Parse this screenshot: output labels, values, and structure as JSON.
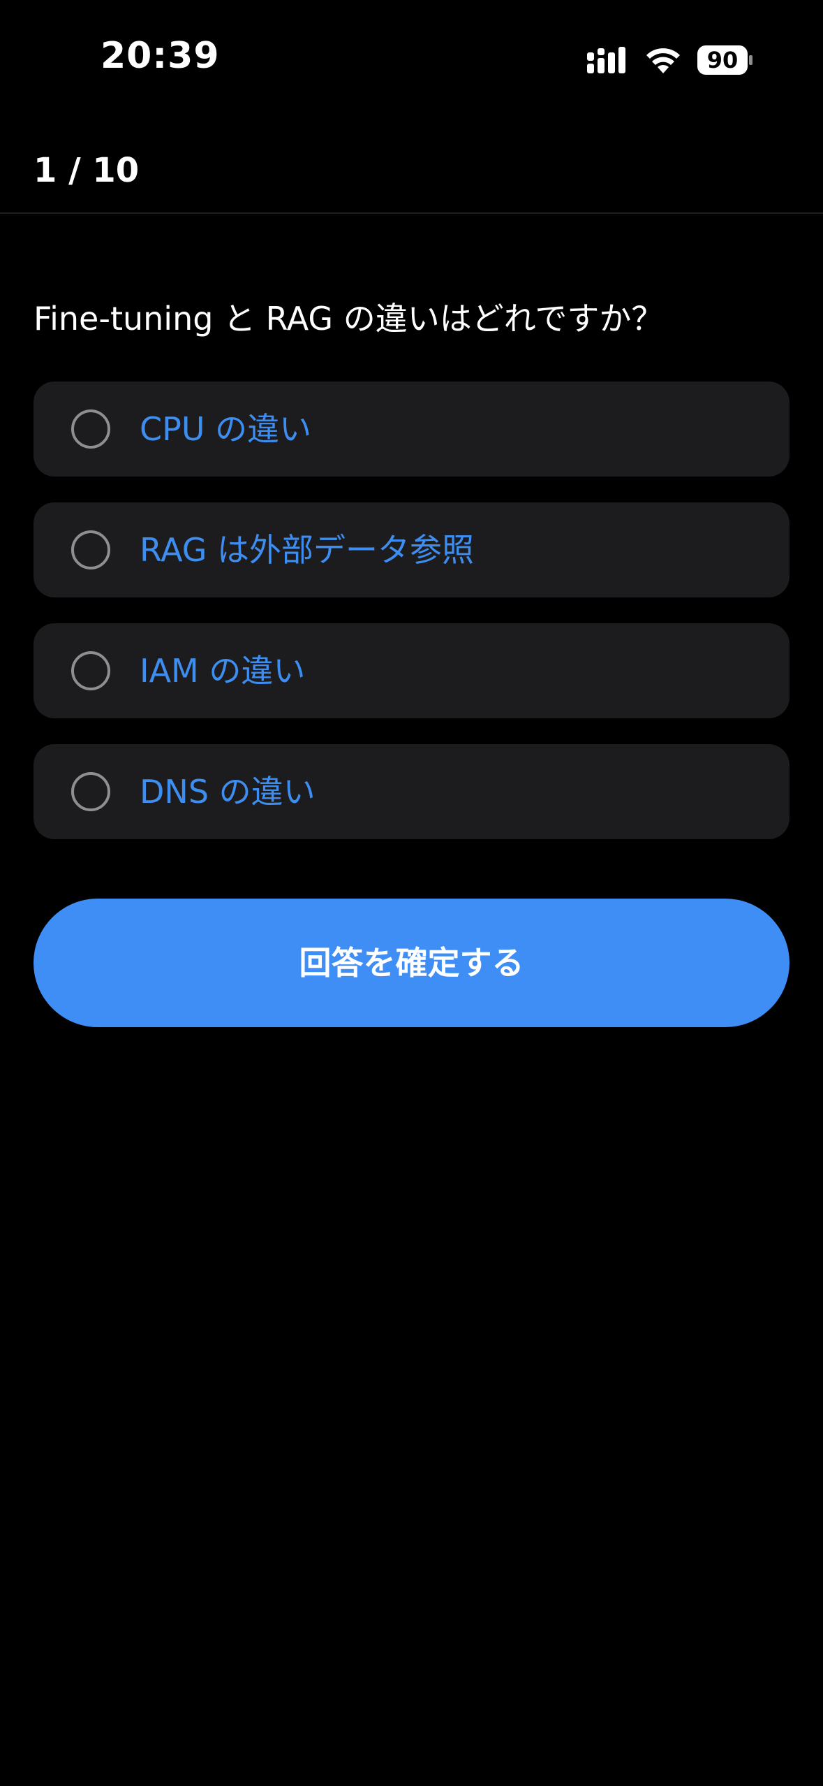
{
  "status_bar": {
    "time": "20:39",
    "battery_level": "90",
    "icons": [
      "signal-icon",
      "wifi-icon",
      "battery-icon"
    ]
  },
  "quiz": {
    "progress": "1 / 10",
    "question": "Fine-tuning と RAG の違いはどれですか？",
    "options": [
      {
        "label": "CPU の違い",
        "selected": false
      },
      {
        "label": "RAG は外部データ参照",
        "selected": false
      },
      {
        "label": "IAM の違い",
        "selected": false
      },
      {
        "label": "DNS の違い",
        "selected": false
      }
    ],
    "submit_label": "回答を確定する"
  },
  "colors": {
    "background": "#000000",
    "card": "#1c1c1e",
    "accent": "#3f8ef5",
    "option_text": "#3d8ef0",
    "radio_border": "#8e8e93"
  }
}
